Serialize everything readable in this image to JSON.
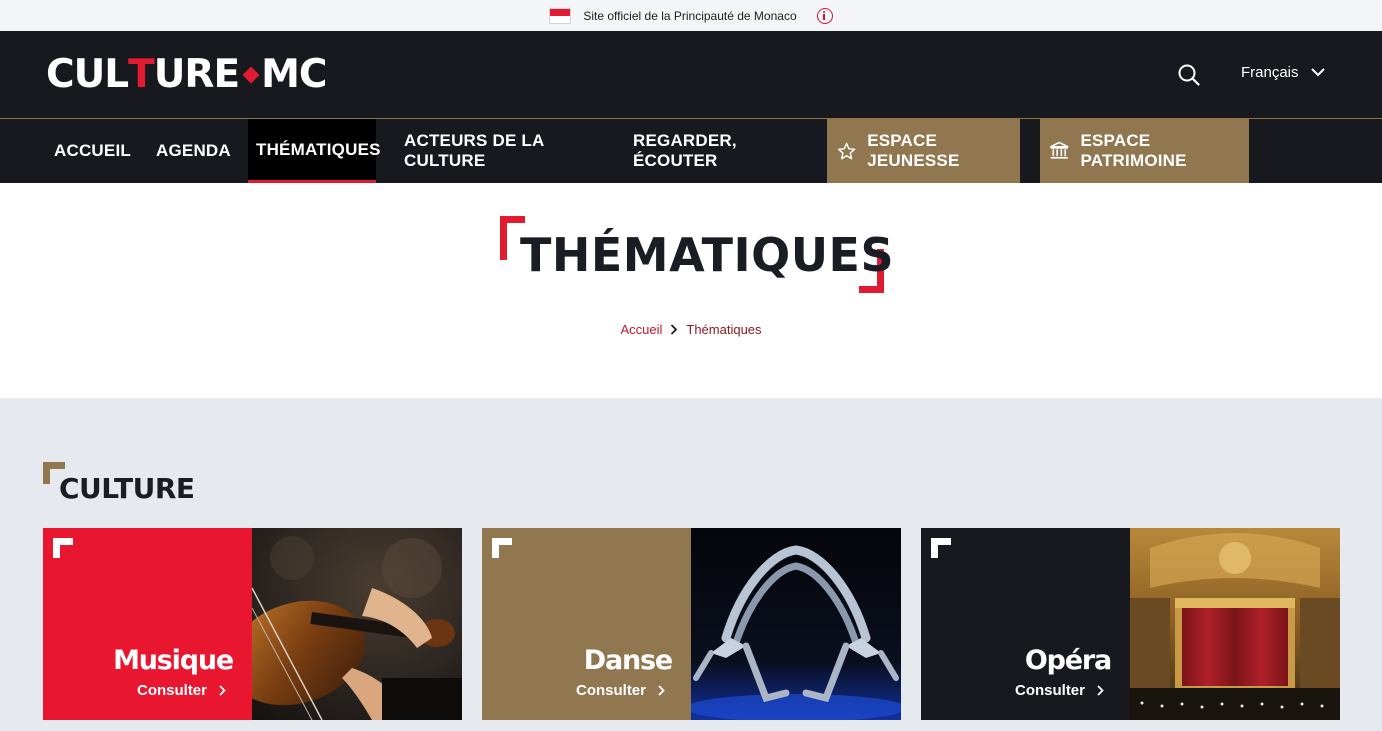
{
  "topbar": {
    "official_text": "Site officiel de la Principauté de Monaco"
  },
  "header": {
    "logo": {
      "part1": "CUL",
      "part2": "T",
      "part3": "URE",
      "part4": "MC"
    },
    "language": "Français"
  },
  "nav": {
    "items": [
      {
        "label": "ACCUEIL"
      },
      {
        "label": "AGENDA"
      },
      {
        "label": "THÉMATIQUES",
        "active": true
      },
      {
        "label": "ACTEURS DE LA CULTURE"
      },
      {
        "label": "REGARDER, ÉCOUTER"
      },
      {
        "label": "ESPACE JEUNESSE",
        "icon": "star-icon"
      },
      {
        "label": "ESPACE PATRIMOINE",
        "icon": "museum-icon"
      }
    ]
  },
  "page": {
    "title": "THÉMATIQUES",
    "breadcrumb": {
      "home": "Accueil",
      "current": "Thématiques"
    }
  },
  "section": {
    "title": "CULTURE",
    "cards": [
      {
        "title": "Musique",
        "link": "Consulter",
        "panel_color": "#e8172f",
        "image": "violin-photo"
      },
      {
        "title": "Danse",
        "link": "Consulter",
        "panel_color": "#917750",
        "image": "dancers-photo"
      },
      {
        "title": "Opéra",
        "link": "Consulter",
        "panel_color": "#17191f",
        "image": "opera-hall-photo"
      }
    ]
  },
  "colors": {
    "brand_red": "#e21b33",
    "gold": "#917750",
    "dark": "#17191f",
    "section_bg": "#e6eaee"
  }
}
